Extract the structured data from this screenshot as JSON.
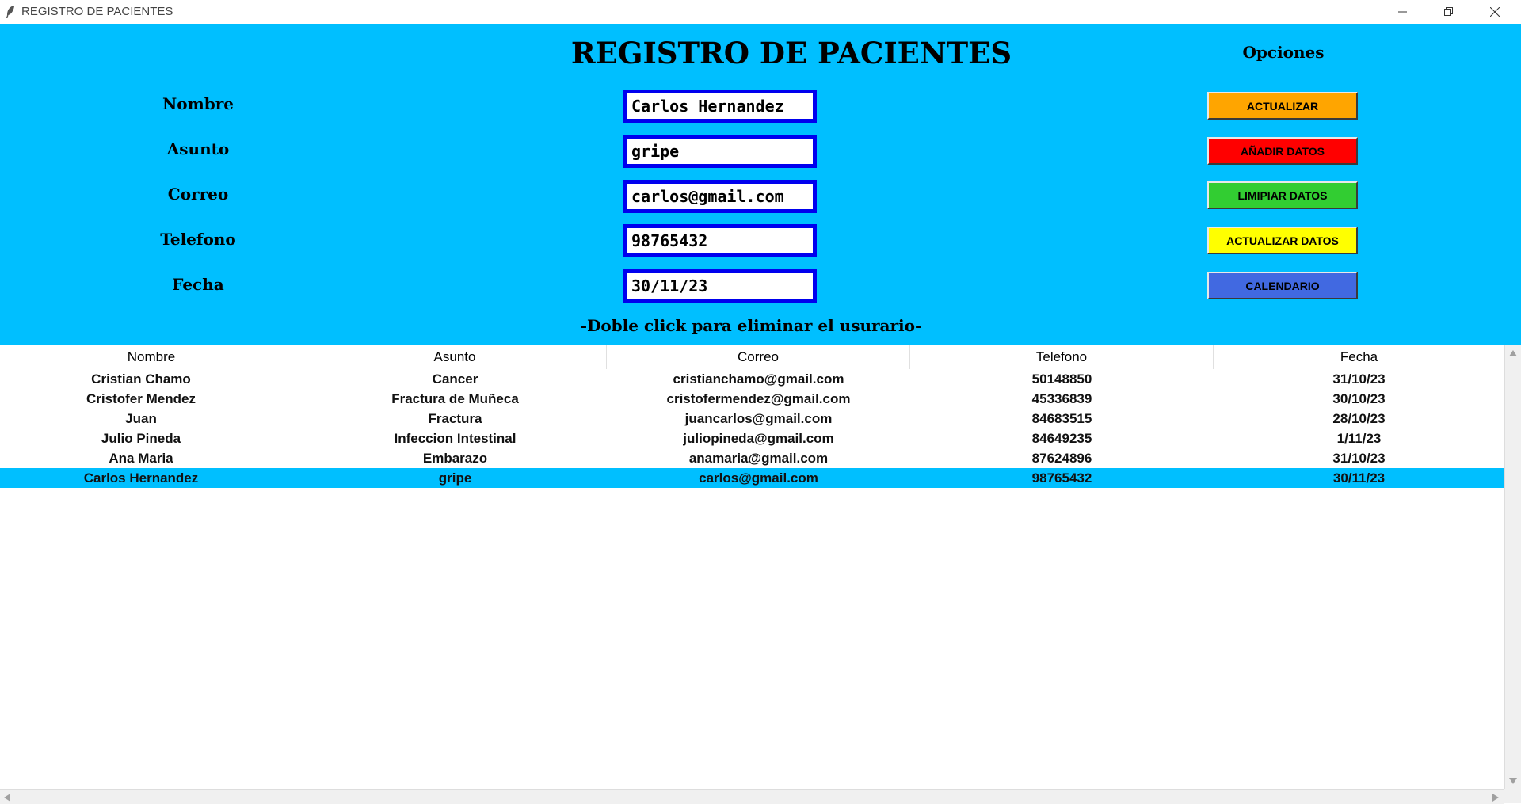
{
  "window": {
    "title": "REGISTRO DE PACIENTES",
    "icons": [
      "feather-icon",
      "minimize-icon",
      "restore-icon",
      "close-icon"
    ]
  },
  "form": {
    "title": "REGISTRO DE PACIENTES",
    "options_label": "Opciones",
    "fields": [
      {
        "label": "Nombre",
        "value": "Carlos Hernandez"
      },
      {
        "label": "Asunto",
        "value": "gripe"
      },
      {
        "label": "Correo",
        "value": "carlos@gmail.com"
      },
      {
        "label": "Telefono",
        "value": "98765432"
      },
      {
        "label": "Fecha",
        "value": "30/11/23"
      }
    ],
    "buttons": [
      {
        "label": "ACTUALIZAR",
        "color": "#ffa500"
      },
      {
        "label": "AÑADIR DATOS",
        "color": "#ff0000"
      },
      {
        "label": "LIMIPIAR DATOS",
        "color": "#32cd32"
      },
      {
        "label": "ACTUALIZAR DATOS",
        "color": "#ffff00"
      },
      {
        "label": "CALENDARIO",
        "color": "#4169e1"
      }
    ],
    "hint": "-Doble click para eliminar el usurario-",
    "background": "#00bfff",
    "input_border": "#0000ee"
  },
  "table": {
    "columns": [
      "Nombre",
      "Asunto",
      "Correo",
      "Telefono",
      "Fecha"
    ],
    "rows": [
      [
        "Cristian Chamo",
        "Cancer",
        "cristianchamo@gmail.com",
        "50148850",
        "31/10/23"
      ],
      [
        "Cristofer Mendez",
        "Fractura de Muñeca",
        "cristofermendez@gmail.com",
        "45336839",
        "30/10/23"
      ],
      [
        "Juan",
        "Fractura",
        "juancarlos@gmail.com",
        "84683515",
        "28/10/23"
      ],
      [
        "Julio Pineda",
        "Infeccion Intestinal",
        "juliopineda@gmail.com",
        "84649235",
        "1/11/23"
      ],
      [
        "Ana Maria",
        "Embarazo",
        "anamaria@gmail.com",
        "87624896",
        "31/10/23"
      ],
      [
        "Carlos Hernandez",
        "gripe",
        "carlos@gmail.com",
        "98765432",
        "30/11/23"
      ]
    ],
    "selected_row": 5,
    "selected_color": "#00bfff"
  }
}
